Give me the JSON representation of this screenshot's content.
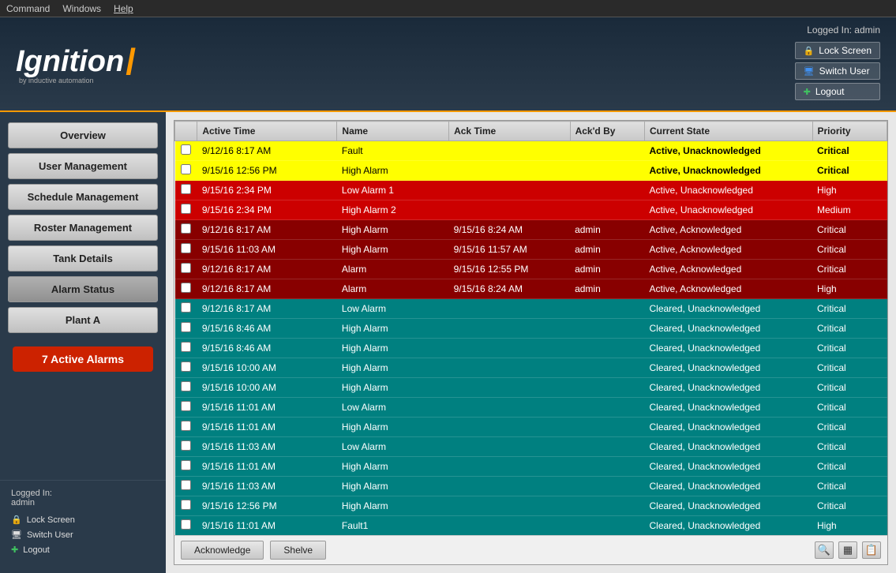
{
  "menubar": {
    "items": [
      "Command",
      "Windows",
      "Help"
    ]
  },
  "header": {
    "logo": "Ignition",
    "logo_slash": "/",
    "logo_sub": "by inductive automation",
    "logged_in_label": "Logged In: admin",
    "buttons": [
      {
        "label": "Lock Screen",
        "icon": "lock",
        "name": "lock-screen-header"
      },
      {
        "label": "Switch User",
        "icon": "switch",
        "name": "switch-user-header"
      },
      {
        "label": "Logout",
        "icon": "logout",
        "name": "logout-header"
      }
    ]
  },
  "sidebar": {
    "nav_items": [
      {
        "label": "Overview",
        "name": "overview"
      },
      {
        "label": "User Management",
        "name": "user-management"
      },
      {
        "label": "Schedule Management",
        "name": "schedule-management"
      },
      {
        "label": "Roster Management",
        "name": "roster-management"
      },
      {
        "label": "Tank Details",
        "name": "tank-details"
      },
      {
        "label": "Alarm Status",
        "name": "alarm-status"
      },
      {
        "label": "Plant A",
        "name": "plant-a"
      }
    ],
    "active_alarms_badge": "7 Active Alarms",
    "logged_in_label": "Logged In:",
    "logged_in_user": "admin",
    "footer_buttons": [
      {
        "label": "Lock Screen",
        "icon": "lock",
        "name": "lock-screen-sidebar"
      },
      {
        "label": "Switch User",
        "icon": "switch",
        "name": "switch-user-sidebar"
      },
      {
        "label": "Logout",
        "icon": "logout",
        "name": "logout-sidebar"
      }
    ]
  },
  "alarm_table": {
    "columns": [
      "",
      "Active Time",
      "Name",
      "Ack Time",
      "Ack'd By",
      "Current State",
      "Priority"
    ],
    "rows": [
      {
        "checked": false,
        "active_time": "9/12/16 8:17 AM",
        "name": "Fault",
        "ack_time": "",
        "ack_by": "",
        "state": "Active, Unacknowledged",
        "priority": "Critical",
        "row_class": "row-yellow"
      },
      {
        "checked": false,
        "active_time": "9/15/16 12:56 PM",
        "name": "High Alarm",
        "ack_time": "",
        "ack_by": "",
        "state": "Active, Unacknowledged",
        "priority": "Critical",
        "row_class": "row-yellow"
      },
      {
        "checked": false,
        "active_time": "9/15/16 2:34 PM",
        "name": "Low Alarm 1",
        "ack_time": "",
        "ack_by": "",
        "state": "Active, Unacknowledged",
        "priority": "High",
        "row_class": "row-red"
      },
      {
        "checked": false,
        "active_time": "9/15/16 2:34 PM",
        "name": "High Alarm 2",
        "ack_time": "",
        "ack_by": "",
        "state": "Active, Unacknowledged",
        "priority": "Medium",
        "row_class": "row-red"
      },
      {
        "checked": false,
        "active_time": "9/12/16 8:17 AM",
        "name": "High Alarm",
        "ack_time": "9/15/16 8:24 AM",
        "ack_by": "admin",
        "state": "Active, Acknowledged",
        "priority": "Critical",
        "row_class": "row-dark-red"
      },
      {
        "checked": false,
        "active_time": "9/15/16 11:03 AM",
        "name": "High Alarm",
        "ack_time": "9/15/16 11:57 AM",
        "ack_by": "admin",
        "state": "Active, Acknowledged",
        "priority": "Critical",
        "row_class": "row-dark-red"
      },
      {
        "checked": false,
        "active_time": "9/12/16 8:17 AM",
        "name": "Alarm",
        "ack_time": "9/15/16 12:55 PM",
        "ack_by": "admin",
        "state": "Active, Acknowledged",
        "priority": "Critical",
        "row_class": "row-dark-red"
      },
      {
        "checked": false,
        "active_time": "9/12/16 8:17 AM",
        "name": "Alarm",
        "ack_time": "9/15/16 8:24 AM",
        "ack_by": "admin",
        "state": "Active, Acknowledged",
        "priority": "High",
        "row_class": "row-dark-red"
      },
      {
        "checked": false,
        "active_time": "9/12/16 8:17 AM",
        "name": "Low Alarm",
        "ack_time": "",
        "ack_by": "",
        "state": "Cleared, Unacknowledged",
        "priority": "Critical",
        "row_class": "row-teal"
      },
      {
        "checked": false,
        "active_time": "9/15/16 8:46 AM",
        "name": "High Alarm",
        "ack_time": "",
        "ack_by": "",
        "state": "Cleared, Unacknowledged",
        "priority": "Critical",
        "row_class": "row-teal"
      },
      {
        "checked": false,
        "active_time": "9/15/16 8:46 AM",
        "name": "High Alarm",
        "ack_time": "",
        "ack_by": "",
        "state": "Cleared, Unacknowledged",
        "priority": "Critical",
        "row_class": "row-teal"
      },
      {
        "checked": false,
        "active_time": "9/15/16 10:00 AM",
        "name": "High Alarm",
        "ack_time": "",
        "ack_by": "",
        "state": "Cleared, Unacknowledged",
        "priority": "Critical",
        "row_class": "row-teal"
      },
      {
        "checked": false,
        "active_time": "9/15/16 10:00 AM",
        "name": "High Alarm",
        "ack_time": "",
        "ack_by": "",
        "state": "Cleared, Unacknowledged",
        "priority": "Critical",
        "row_class": "row-teal"
      },
      {
        "checked": false,
        "active_time": "9/15/16 11:01 AM",
        "name": "Low Alarm",
        "ack_time": "",
        "ack_by": "",
        "state": "Cleared, Unacknowledged",
        "priority": "Critical",
        "row_class": "row-teal"
      },
      {
        "checked": false,
        "active_time": "9/15/16 11:01 AM",
        "name": "High Alarm",
        "ack_time": "",
        "ack_by": "",
        "state": "Cleared, Unacknowledged",
        "priority": "Critical",
        "row_class": "row-teal"
      },
      {
        "checked": false,
        "active_time": "9/15/16 11:03 AM",
        "name": "Low Alarm",
        "ack_time": "",
        "ack_by": "",
        "state": "Cleared, Unacknowledged",
        "priority": "Critical",
        "row_class": "row-teal"
      },
      {
        "checked": false,
        "active_time": "9/15/16 11:01 AM",
        "name": "High Alarm",
        "ack_time": "",
        "ack_by": "",
        "state": "Cleared, Unacknowledged",
        "priority": "Critical",
        "row_class": "row-teal"
      },
      {
        "checked": false,
        "active_time": "9/15/16 11:03 AM",
        "name": "High Alarm",
        "ack_time": "",
        "ack_by": "",
        "state": "Cleared, Unacknowledged",
        "priority": "Critical",
        "row_class": "row-teal"
      },
      {
        "checked": false,
        "active_time": "9/15/16 12:56 PM",
        "name": "High Alarm",
        "ack_time": "",
        "ack_by": "",
        "state": "Cleared, Unacknowledged",
        "priority": "Critical",
        "row_class": "row-teal"
      },
      {
        "checked": false,
        "active_time": "9/15/16 11:01 AM",
        "name": "Fault1",
        "ack_time": "",
        "ack_by": "",
        "state": "Cleared, Unacknowledged",
        "priority": "High",
        "row_class": "row-teal"
      }
    ],
    "toolbar": {
      "acknowledge_label": "Acknowledge",
      "shelve_label": "Shelve"
    }
  }
}
